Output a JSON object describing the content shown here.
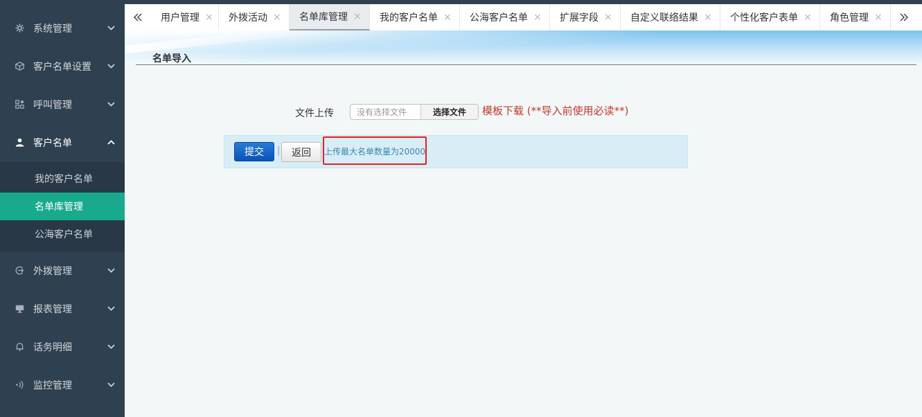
{
  "sidebar": {
    "items": [
      {
        "label": "系统管理",
        "icon": "gear-icon"
      },
      {
        "label": "客户名单设置",
        "icon": "cube-icon"
      },
      {
        "label": "呼叫管理",
        "icon": "grid-icon"
      },
      {
        "label": "客户名单",
        "icon": "user-icon"
      },
      {
        "label": "外拨管理",
        "icon": "outbound-icon"
      },
      {
        "label": "报表管理",
        "icon": "report-icon"
      },
      {
        "label": "话务明细",
        "icon": "bell-icon"
      },
      {
        "label": "监控管理",
        "icon": "monitor-icon"
      }
    ],
    "submenu": [
      {
        "label": "我的客户名单"
      },
      {
        "label": "名单库管理"
      },
      {
        "label": "公海客户名单"
      }
    ]
  },
  "tabs": [
    {
      "label": "用户管理"
    },
    {
      "label": "外拨活动"
    },
    {
      "label": "名单库管理"
    },
    {
      "label": "我的客户名单"
    },
    {
      "label": "公海客户名单"
    },
    {
      "label": "扩展字段"
    },
    {
      "label": "自定义联络结果"
    },
    {
      "label": "个性化客户表单"
    },
    {
      "label": "角色管理"
    }
  ],
  "tab_close": "×",
  "page": {
    "title": "名单导入",
    "upload_label": "文件上传",
    "file_placeholder": "没有选择文件",
    "choose_file": "选择文件",
    "template_link": "模板下载 (**导入前使用必读**)",
    "submit": "提交",
    "separator": "|",
    "back": "返回",
    "limit_note": "上传最大名单数量为20000"
  },
  "colors": {
    "sidebar_bg": "#2f4050",
    "active_green": "#19aa8d",
    "link_red": "#c0392b",
    "primary_blue": "#0a54b8",
    "highlight_red": "#e02020"
  }
}
